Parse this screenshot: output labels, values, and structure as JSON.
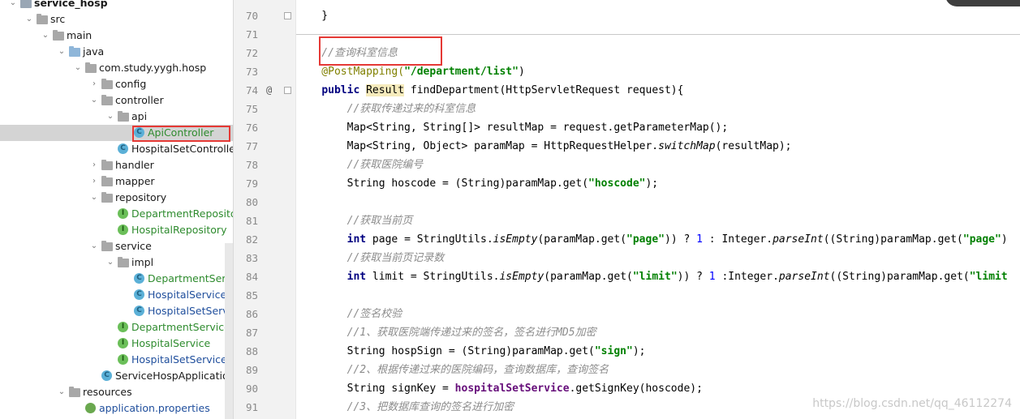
{
  "project_tree": {
    "items": [
      {
        "label": "service_hosp",
        "indent": 0,
        "arrow": "▾",
        "icon": "module-folder-icon",
        "style": "bold"
      },
      {
        "label": "src",
        "indent": 1,
        "arrow": "▾",
        "icon": "folder-icon"
      },
      {
        "label": "main",
        "indent": 2,
        "arrow": "▾",
        "icon": "folder-icon"
      },
      {
        "label": "java",
        "indent": 3,
        "arrow": "▾",
        "icon": "source-folder-icon"
      },
      {
        "label": "com.study.yygh.hosp",
        "indent": 4,
        "arrow": "▾",
        "icon": "package-icon"
      },
      {
        "label": "config",
        "indent": 5,
        "arrow": "›",
        "icon": "package-icon"
      },
      {
        "label": "controller",
        "indent": 5,
        "arrow": "▾",
        "icon": "package-icon"
      },
      {
        "label": "api",
        "indent": 6,
        "arrow": "▾",
        "icon": "package-icon"
      },
      {
        "label": "ApiController",
        "indent": 7,
        "arrow": "",
        "icon": "class-icon",
        "style": "green",
        "selected": true
      },
      {
        "label": "HospitalSetControlle",
        "indent": 6,
        "arrow": "",
        "icon": "class-icon"
      },
      {
        "label": "handler",
        "indent": 5,
        "arrow": "›",
        "icon": "package-icon"
      },
      {
        "label": "mapper",
        "indent": 5,
        "arrow": "›",
        "icon": "package-icon"
      },
      {
        "label": "repository",
        "indent": 5,
        "arrow": "▾",
        "icon": "package-icon"
      },
      {
        "label": "DepartmentReposito",
        "indent": 6,
        "arrow": "",
        "icon": "interface-icon",
        "style": "green"
      },
      {
        "label": "HospitalRepository",
        "indent": 6,
        "arrow": "",
        "icon": "interface-icon",
        "style": "green"
      },
      {
        "label": "service",
        "indent": 5,
        "arrow": "▾",
        "icon": "package-icon"
      },
      {
        "label": "impl",
        "indent": 6,
        "arrow": "▾",
        "icon": "package-icon"
      },
      {
        "label": "DepartmentServi",
        "indent": 7,
        "arrow": "",
        "icon": "class-icon",
        "style": "green"
      },
      {
        "label": "HospitalServiceIr",
        "indent": 7,
        "arrow": "",
        "icon": "class-icon",
        "style": "blue"
      },
      {
        "label": "HospitalSetServic",
        "indent": 7,
        "arrow": "",
        "icon": "class-icon",
        "style": "blue"
      },
      {
        "label": "DepartmentService",
        "indent": 6,
        "arrow": "",
        "icon": "interface-icon",
        "style": "green"
      },
      {
        "label": "HospitalService",
        "indent": 6,
        "arrow": "",
        "icon": "interface-icon",
        "style": "green"
      },
      {
        "label": "HospitalSetService",
        "indent": 6,
        "arrow": "",
        "icon": "interface-icon",
        "style": "blue"
      },
      {
        "label": "ServiceHospApplication",
        "indent": 5,
        "arrow": "",
        "icon": "spring-class-icon"
      },
      {
        "label": "resources",
        "indent": 3,
        "arrow": "▾",
        "icon": "resources-folder-icon"
      },
      {
        "label": "application.properties",
        "indent": 4,
        "arrow": "",
        "icon": "properties-leaf-icon",
        "style": "blue"
      }
    ]
  },
  "gutter": {
    "line_numbers": [
      "70",
      "71",
      "72",
      "73",
      "74",
      "75",
      "76",
      "77",
      "78",
      "79",
      "80",
      "81",
      "82",
      "83",
      "84",
      "85",
      "86",
      "87",
      "88",
      "89",
      "90",
      "91"
    ],
    "override_marker_line": "74",
    "override_marker": "@"
  },
  "code_lines": [
    {
      "n": "70",
      "parts": [
        {
          "t": "    }",
          "c": ""
        }
      ]
    },
    {
      "n": "71",
      "parts": []
    },
    {
      "n": "72",
      "parts": [
        {
          "t": "    //查询科室信息",
          "c": "cmt"
        }
      ]
    },
    {
      "n": "73",
      "parts": [
        {
          "t": "    @PostMapping(",
          "c": "ann"
        },
        {
          "t": "\"/department/list\"",
          "c": "str"
        },
        {
          "t": ")",
          "c": ""
        }
      ]
    },
    {
      "n": "74",
      "parts": [
        {
          "t": "    ",
          "c": ""
        },
        {
          "t": "public",
          "c": "kw"
        },
        {
          "t": " ",
          "c": ""
        },
        {
          "t": "Result",
          "c": "hl"
        },
        {
          "t": " findDepartment(HttpServletRequest request){",
          "c": ""
        }
      ]
    },
    {
      "n": "75",
      "parts": [
        {
          "t": "        //获取传递过来的科室信息",
          "c": "cmt"
        }
      ]
    },
    {
      "n": "76",
      "parts": [
        {
          "t": "        Map<String, String[]> resultMap = request.getParameterMap();",
          "c": ""
        }
      ]
    },
    {
      "n": "77",
      "parts": [
        {
          "t": "        Map<String, Object> paramMap = HttpRequestHelper.",
          "c": ""
        },
        {
          "t": "switchMap",
          "c": "ital"
        },
        {
          "t": "(resultMap);",
          "c": ""
        }
      ]
    },
    {
      "n": "78",
      "parts": [
        {
          "t": "        //获取医院编号",
          "c": "cmt"
        }
      ]
    },
    {
      "n": "79",
      "parts": [
        {
          "t": "        String hoscode = (String)paramMap.get(",
          "c": ""
        },
        {
          "t": "\"hoscode\"",
          "c": "str"
        },
        {
          "t": ");",
          "c": ""
        }
      ]
    },
    {
      "n": "80",
      "parts": []
    },
    {
      "n": "81",
      "parts": [
        {
          "t": "        //获取当前页",
          "c": "cmt"
        }
      ]
    },
    {
      "n": "82",
      "parts": [
        {
          "t": "        ",
          "c": ""
        },
        {
          "t": "int",
          "c": "kw"
        },
        {
          "t": " page = StringUtils.",
          "c": ""
        },
        {
          "t": "isEmpty",
          "c": "ital"
        },
        {
          "t": "(paramMap.get(",
          "c": ""
        },
        {
          "t": "\"page\"",
          "c": "str"
        },
        {
          "t": ")) ? ",
          "c": ""
        },
        {
          "t": "1",
          "c": "num"
        },
        {
          "t": " : Integer.",
          "c": ""
        },
        {
          "t": "parseInt",
          "c": "ital"
        },
        {
          "t": "((String)paramMap.get(",
          "c": ""
        },
        {
          "t": "\"page\"",
          "c": "str"
        },
        {
          "t": ")",
          "c": ""
        }
      ]
    },
    {
      "n": "83",
      "parts": [
        {
          "t": "        //获取当前页记录数",
          "c": "cmt"
        }
      ]
    },
    {
      "n": "84",
      "parts": [
        {
          "t": "        ",
          "c": ""
        },
        {
          "t": "int",
          "c": "kw"
        },
        {
          "t": " limit = StringUtils.",
          "c": ""
        },
        {
          "t": "isEmpty",
          "c": "ital"
        },
        {
          "t": "(paramMap.get(",
          "c": ""
        },
        {
          "t": "\"limit\"",
          "c": "str"
        },
        {
          "t": ")) ? ",
          "c": ""
        },
        {
          "t": "1",
          "c": "num"
        },
        {
          "t": " :Integer.",
          "c": ""
        },
        {
          "t": "parseInt",
          "c": "ital"
        },
        {
          "t": "((String)paramMap.get(",
          "c": ""
        },
        {
          "t": "\"limit",
          "c": "str"
        }
      ]
    },
    {
      "n": "85",
      "parts": []
    },
    {
      "n": "86",
      "parts": [
        {
          "t": "        //签名校验",
          "c": "cmt"
        }
      ]
    },
    {
      "n": "87",
      "parts": [
        {
          "t": "        //1、获取医院端传递过来的签名，签名进行MD5加密",
          "c": "cmt"
        }
      ]
    },
    {
      "n": "88",
      "parts": [
        {
          "t": "        String hospSign = (String)paramMap.get(",
          "c": ""
        },
        {
          "t": "\"sign\"",
          "c": "str"
        },
        {
          "t": ");",
          "c": ""
        }
      ]
    },
    {
      "n": "89",
      "parts": [
        {
          "t": "        //2、根据传递过来的医院编码，查询数据库，查询签名",
          "c": "cmt"
        }
      ]
    },
    {
      "n": "90",
      "parts": [
        {
          "t": "        String signKey = ",
          "c": ""
        },
        {
          "t": "hospitalSetService",
          "c": "fld"
        },
        {
          "t": ".getSignKey(hoscode);",
          "c": ""
        }
      ]
    },
    {
      "n": "91",
      "parts": [
        {
          "t": "        //3、把数据库查询的签名进行加密",
          "c": "cmt"
        }
      ]
    }
  ],
  "watermark": "https://blog.csdn.net/qq_46112274",
  "colors": {
    "comment": "#8c8c8c",
    "keyword": "#000080",
    "string": "#008000",
    "annotation": "#808000",
    "highlight_box": "#e53935",
    "selection": "#d4d4d4"
  }
}
